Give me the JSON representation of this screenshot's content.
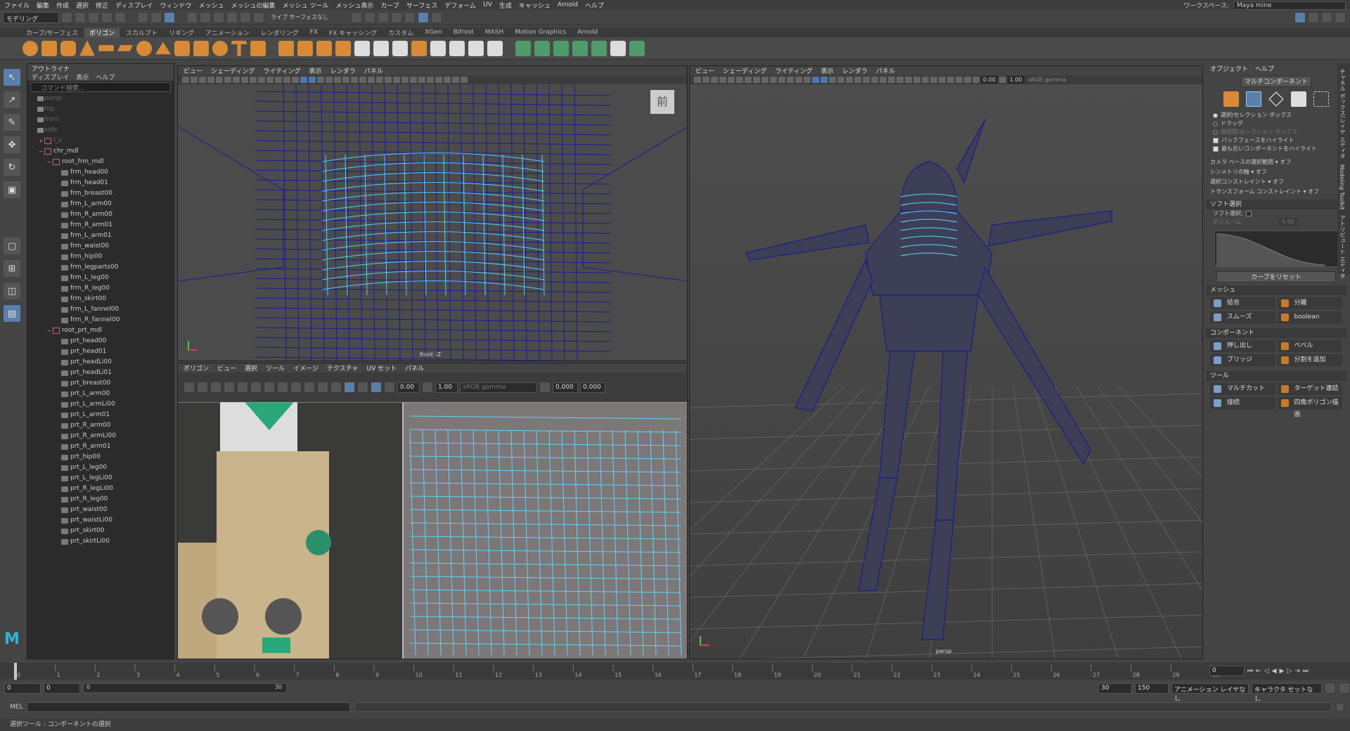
{
  "menubar": {
    "items": [
      "ファイル",
      "編集",
      "作成",
      "選択",
      "修正",
      "ディスプレイ",
      "ウィンドウ",
      "メッシュ",
      "メッシュの編集",
      "メッシュ ツール",
      "メッシュ表示",
      "カーブ",
      "サーフェス",
      "デフォーム",
      "UV",
      "生成",
      "キャッシュ",
      "Arnold",
      "ヘルプ"
    ],
    "workspace_label": "ワークスペース:",
    "workspace_value": "Maya mine"
  },
  "statusline": {
    "mode": "モデリング",
    "live_surface": "ライブ サーフェスなし"
  },
  "shelf": {
    "tabs": [
      "カーブ/サーフェス",
      "ポリゴン",
      "スカルプト",
      "リギング",
      "アニメーション",
      "レンダリング",
      "FX",
      "FX キャッシング",
      "カスタム",
      "XGen",
      "Bifrost",
      "MASH",
      "Motion Graphics",
      "Arnold"
    ],
    "active_tab": "ポリゴン"
  },
  "outliner": {
    "title": "アウトライナ",
    "menu": [
      "ディスプレイ",
      "表示",
      "ヘルプ"
    ],
    "search_placeholder": "コマンド検索...",
    "items": [
      {
        "label": "persp",
        "depth": 0,
        "dim": true,
        "type": "cam"
      },
      {
        "label": "top",
        "depth": 0,
        "dim": true,
        "type": "cam"
      },
      {
        "label": "front",
        "depth": 0,
        "dim": true,
        "type": "cam"
      },
      {
        "label": "side",
        "depth": 0,
        "dim": true,
        "type": "cam"
      },
      {
        "label": "l_v",
        "depth": 0,
        "dim": true,
        "type": "grp",
        "exp": "+"
      },
      {
        "label": "chr_mdl",
        "depth": 0,
        "dim": false,
        "type": "grp",
        "exp": "−"
      },
      {
        "label": "root_frm_mdl",
        "depth": 1,
        "dim": false,
        "type": "grp",
        "exp": "−"
      },
      {
        "label": "frm_head00",
        "depth": 2,
        "dim": false,
        "type": "mesh"
      },
      {
        "label": "frm_head01",
        "depth": 2,
        "dim": false,
        "type": "mesh"
      },
      {
        "label": "frm_breast00",
        "depth": 2,
        "dim": false,
        "type": "mesh"
      },
      {
        "label": "frm_L_arm00",
        "depth": 2,
        "dim": false,
        "type": "mesh"
      },
      {
        "label": "frm_R_arm00",
        "depth": 2,
        "dim": false,
        "type": "mesh"
      },
      {
        "label": "frm_R_arm01",
        "depth": 2,
        "dim": false,
        "type": "mesh"
      },
      {
        "label": "frm_L_arm01",
        "depth": 2,
        "dim": false,
        "type": "mesh"
      },
      {
        "label": "frm_waist00",
        "depth": 2,
        "dim": false,
        "type": "mesh"
      },
      {
        "label": "frm_hip00",
        "depth": 2,
        "dim": false,
        "type": "mesh"
      },
      {
        "label": "frm_legparts00",
        "depth": 2,
        "dim": false,
        "type": "mesh"
      },
      {
        "label": "frm_L_leg00",
        "depth": 2,
        "dim": false,
        "type": "mesh"
      },
      {
        "label": "frm_R_leg00",
        "depth": 2,
        "dim": false,
        "type": "mesh"
      },
      {
        "label": "frm_skirt00",
        "depth": 2,
        "dim": false,
        "type": "mesh"
      },
      {
        "label": "frm_L_fannel00",
        "depth": 2,
        "dim": false,
        "type": "mesh"
      },
      {
        "label": "frm_R_fannel00",
        "depth": 2,
        "dim": false,
        "type": "mesh"
      },
      {
        "label": "root_prt_mdl",
        "depth": 1,
        "dim": false,
        "type": "grp",
        "exp": "−"
      },
      {
        "label": "prt_head00",
        "depth": 2,
        "dim": false,
        "type": "mesh"
      },
      {
        "label": "prt_head01",
        "depth": 2,
        "dim": false,
        "type": "mesh"
      },
      {
        "label": "prt_headLi00",
        "depth": 2,
        "dim": false,
        "type": "mesh"
      },
      {
        "label": "prt_headLi01",
        "depth": 2,
        "dim": false,
        "type": "mesh"
      },
      {
        "label": "prt_breast00",
        "depth": 2,
        "dim": false,
        "type": "mesh"
      },
      {
        "label": "prt_L_arm00",
        "depth": 2,
        "dim": false,
        "type": "mesh"
      },
      {
        "label": "prt_L_armLi00",
        "depth": 2,
        "dim": false,
        "type": "mesh"
      },
      {
        "label": "prt_L_arm01",
        "depth": 2,
        "dim": false,
        "type": "mesh"
      },
      {
        "label": "prt_R_arm00",
        "depth": 2,
        "dim": false,
        "type": "mesh"
      },
      {
        "label": "prt_R_armLi00",
        "depth": 2,
        "dim": false,
        "type": "mesh"
      },
      {
        "label": "prt_R_arm01",
        "depth": 2,
        "dim": false,
        "type": "mesh"
      },
      {
        "label": "prt_hip00",
        "depth": 2,
        "dim": false,
        "type": "mesh"
      },
      {
        "label": "prt_L_leg00",
        "depth": 2,
        "dim": false,
        "type": "mesh"
      },
      {
        "label": "prt_L_legLi00",
        "depth": 2,
        "dim": false,
        "type": "mesh"
      },
      {
        "label": "prt_R_legLi00",
        "depth": 2,
        "dim": false,
        "type": "mesh"
      },
      {
        "label": "prt_R_leg00",
        "depth": 2,
        "dim": false,
        "type": "mesh"
      },
      {
        "label": "prt_waist00",
        "depth": 2,
        "dim": false,
        "type": "mesh"
      },
      {
        "label": "prt_waistLi00",
        "depth": 2,
        "dim": false,
        "type": "mesh"
      },
      {
        "label": "prt_skirt00",
        "depth": 2,
        "dim": false,
        "type": "mesh"
      },
      {
        "label": "prt_skirtLi00",
        "depth": 2,
        "dim": false,
        "type": "mesh"
      }
    ]
  },
  "viewport_front": {
    "menu": [
      "ビュー",
      "シェーディング",
      "ライティング",
      "表示",
      "レンダラ",
      "パネル"
    ],
    "camera_label": "front -Z",
    "view_cube_label": "前"
  },
  "uv_editor": {
    "menu": [
      "ポリゴン",
      "ビュー",
      "選択",
      "ツール",
      "イメージ",
      "テクスチャ",
      "UV セット",
      "パネル"
    ],
    "val_a": "0.00",
    "val_b": "1.00",
    "val_c": "0.000",
    "val_d": "0.000",
    "colorspace": "sRGB gamma"
  },
  "viewport_persp": {
    "menu": [
      "ビュー",
      "シェーディング",
      "ライティング",
      "表示",
      "レンダラ",
      "パネル"
    ],
    "camera_label": "persp",
    "val_a": "0.00",
    "val_b": "1.00",
    "colorspace": "sRGB gamma"
  },
  "modeling_toolkit": {
    "menu": [
      "オブジェクト",
      "ヘルプ"
    ],
    "multi_component": "マルチコンポーネント",
    "select_options": [
      {
        "label": "選択/セレクション ボックス",
        "kind": "radio",
        "on": true
      },
      {
        "label": "ドラッグ",
        "kind": "radio",
        "on": false
      },
      {
        "label": "微調整/セレクション ボックス",
        "kind": "radio",
        "on": false,
        "dim": true
      },
      {
        "label": "バックフェースをハイライト",
        "kind": "check",
        "on": true
      },
      {
        "label": "最も近いコンポーネントをハイライト",
        "kind": "check",
        "on": true
      }
    ],
    "options": [
      {
        "label": "カメラ ベースの選択範囲",
        "value": "オフ"
      },
      {
        "label": "シンメトリの軸",
        "value": "オフ"
      },
      {
        "label": "選択コンストレイント",
        "value": "オフ"
      },
      {
        "label": "トランスフォーム コンストレイント",
        "value": "オフ"
      }
    ],
    "soft_select_header": "ソフト選択",
    "soft_select_label": "ソフト選択:",
    "volume_label": "ボリューム",
    "volume_value": "5.00",
    "reset_curve": "カーブをリセット",
    "mesh_header": "メッシュ",
    "mesh_buttons": [
      "結合",
      "分離",
      "スムーズ",
      "boolean"
    ],
    "component_header": "コンポーネント",
    "component_buttons": [
      "押し出し",
      "ベベル",
      "ブリッジ",
      "分割を追加"
    ],
    "tool_header": "ツール",
    "tool_buttons": [
      "マルチカット",
      "ターゲット連結",
      "接続",
      "四角ポリゴン描画"
    ]
  },
  "vertical_tabs": [
    "チャネル ボックス/レイヤ エディタ",
    "Modeling Toolkit",
    "アトリビュート エディタ"
  ],
  "timeline": {
    "ticks": [
      "0",
      "1",
      "2",
      "3",
      "4",
      "5",
      "6",
      "7",
      "8",
      "9",
      "10",
      "11",
      "12",
      "13",
      "14",
      "15",
      "16",
      "17",
      "18",
      "19",
      "20",
      "21",
      "22",
      "23",
      "24",
      "25",
      "26",
      "27",
      "28",
      "29",
      "30"
    ],
    "current_frame": "0"
  },
  "range": {
    "start": "0",
    "inner_start": "0",
    "slider_start": "0",
    "slider_end": "30",
    "inner_end": "30",
    "end": "150",
    "anim_layer": "アニメーション レイヤなし",
    "char_set": "キャラクタ セットなし"
  },
  "command": {
    "mel_label": "MEL"
  },
  "helpline": {
    "text": "選択ツール : コンポーネントの選択"
  }
}
